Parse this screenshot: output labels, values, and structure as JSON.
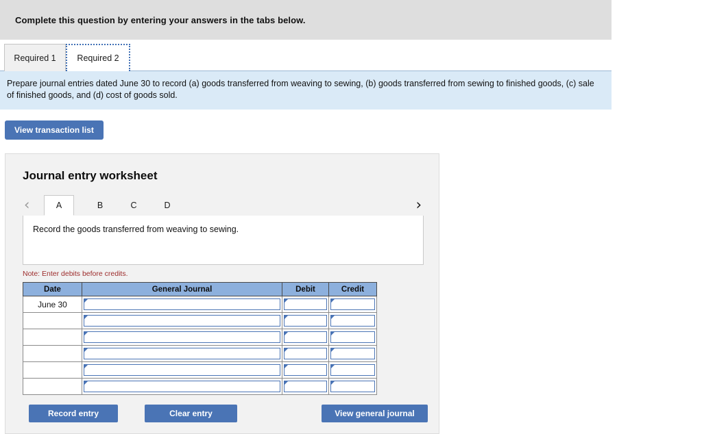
{
  "banner": {
    "text": "Complete this question by entering your answers in the tabs below."
  },
  "required_tabs": {
    "items": [
      {
        "label": "Required 1",
        "active": false
      },
      {
        "label": "Required 2",
        "active": true
      }
    ]
  },
  "instruction": {
    "text": "Prepare journal entries dated June 30 to record (a) goods transferred from weaving to sewing, (b) goods transferred from sewing to finished goods, (c) sale of finished goods, and (d) cost of goods sold."
  },
  "actions": {
    "view_transaction_list": "View transaction list"
  },
  "worksheet": {
    "title": "Journal entry worksheet",
    "nav": {
      "prev_icon": "‹",
      "next_icon": "›"
    },
    "letter_tabs": [
      {
        "label": "A",
        "active": true
      },
      {
        "label": "B",
        "active": false
      },
      {
        "label": "C",
        "active": false
      },
      {
        "label": "D",
        "active": false
      }
    ],
    "description": "Record the goods transferred from weaving to sewing.",
    "note": "Note: Enter debits before credits.",
    "table": {
      "headers": [
        "Date",
        "General Journal",
        "Debit",
        "Credit"
      ],
      "rows": [
        {
          "date": "June 30",
          "general_journal": "",
          "debit": "",
          "credit": ""
        },
        {
          "date": "",
          "general_journal": "",
          "debit": "",
          "credit": ""
        },
        {
          "date": "",
          "general_journal": "",
          "debit": "",
          "credit": ""
        },
        {
          "date": "",
          "general_journal": "",
          "debit": "",
          "credit": ""
        },
        {
          "date": "",
          "general_journal": "",
          "debit": "",
          "credit": ""
        },
        {
          "date": "",
          "general_journal": "",
          "debit": "",
          "credit": ""
        }
      ]
    },
    "buttons": {
      "record_entry": "Record entry",
      "clear_entry": "Clear entry",
      "view_general_journal": "View general journal"
    }
  },
  "colors": {
    "accent_blue": "#4a74b5",
    "table_header_blue": "#8db0dd",
    "instruction_band": "#daeaf7",
    "banner_gray": "#dedede",
    "note_red": "#9c2b2b"
  }
}
